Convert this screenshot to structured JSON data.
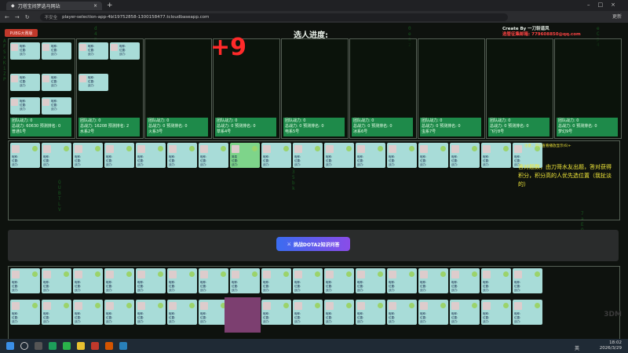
{
  "browser": {
    "tab_title": "刀塔宝间梦选马网站",
    "url": "player-selection-app-4bl19752858-1300158477.tcloudbaseapp.com",
    "security_label": "不安全",
    "profile_label": "更新"
  },
  "header": {
    "red_button_label": "PUBG大赛版",
    "title": "选人进度:",
    "credit_line1": "Create By 一刀斩道风",
    "credit_line2": "选管征集邮箱: 779608850@qq.com",
    "big_number": "+9"
  },
  "teams": [
    {
      "name": "普通1号",
      "score": "团队战力: 0",
      "power": "总战力: 60630",
      "rank": "预测排名: 0"
    },
    {
      "name": "水系2号",
      "score": "团队战力: 0",
      "power": "总战力: 16208",
      "rank": "预测排名: 2"
    },
    {
      "name": "火系3号",
      "score": "团队战力: 0",
      "power": "总战力: 0",
      "rank": "预测排名: 0"
    },
    {
      "name": "草系4号",
      "score": "团队战力: 0",
      "power": "总战力: 0",
      "rank": "预测排名: 0"
    },
    {
      "name": "电系5号",
      "score": "团队战力: 0",
      "power": "总战力: 0",
      "rank": "预测排名: 0"
    },
    {
      "name": "冰系6号",
      "score": "团队战力: 0",
      "power": "总战力: 0",
      "rank": "预测排名: 0"
    },
    {
      "name": "虫系7号",
      "score": "团队战力: 0",
      "power": "总战力: 0",
      "rank": "预测排名: 0"
    },
    {
      "name": "飞行8号",
      "score": "团队战力: 0",
      "power": "总战力: 0",
      "rank": "预测排名: 0"
    },
    {
      "name": "梦幻9号",
      "score": "团队战力: 0",
      "power": "总战力: 0",
      "rank": "预测排名: 0"
    }
  ],
  "member_lines": [
    "昵称:",
    "位置:",
    "战力:"
  ],
  "selected_member_name": "简易",
  "notice": {
    "small": "注意，可以查看播放显示(6)+",
    "text": "答对题数，由刀哥水友出题，答对获得积分，积分高的人优先选位置（我扯淡的）"
  },
  "action_button": {
    "label": "挑战DOTA2知识问答",
    "icon": "swords-icon"
  },
  "watermark": "3DM",
  "tray": {
    "lang": "英",
    "time": "18:02",
    "date": "2026/3/29"
  }
}
